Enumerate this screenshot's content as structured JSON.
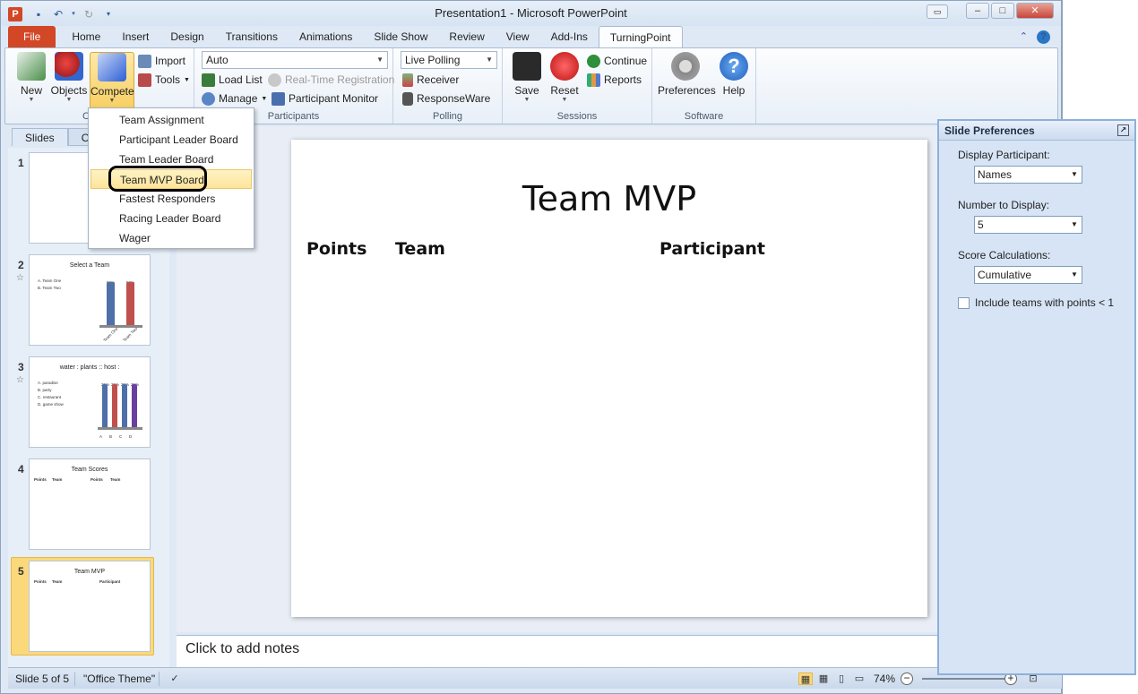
{
  "window": {
    "title": "Presentation1  -  Microsoft PowerPoint",
    "app_icon": "P"
  },
  "tabs": [
    "File",
    "Home",
    "Insert",
    "Design",
    "Transitions",
    "Animations",
    "Slide Show",
    "Review",
    "View",
    "Add-Ins",
    "TurningPoint"
  ],
  "active_tab": "TurningPoint",
  "ribbon": {
    "new": "New",
    "objects": "Objects",
    "compete": "Compete",
    "import": "Import",
    "tools": "Tools",
    "auto_combo": "Auto",
    "load_list": "Load List",
    "realtime_registration": "Real-Time Registration",
    "manage": "Manage",
    "participant_monitor": "Participant Monitor",
    "participants_group": "Participants",
    "polling_combo": "Live Polling",
    "receiver": "Receiver",
    "responseware": "ResponseWare",
    "polling_group": "Polling",
    "save": "Save",
    "reset": "Reset",
    "continue": "Continue",
    "reports": "Reports",
    "sessions_group": "Sessions",
    "preferences": "Preferences",
    "help": "Help",
    "software_group": "Software",
    "content_group_partial": "C"
  },
  "compete_menu": {
    "items": [
      "Team Assignment",
      "Participant Leader Board",
      "Team Leader Board",
      "Team MVP Board",
      "Fastest Responders",
      "Racing Leader Board",
      "Wager"
    ],
    "highlighted": "Team MVP Board"
  },
  "left_pane": {
    "tabs": [
      "Slides",
      "Ou"
    ],
    "slides": [
      {
        "num": "1"
      },
      {
        "num": "2",
        "title": "Select a Team",
        "options": [
          "A. Team One",
          "B. Team Two"
        ],
        "bar_labels": [
          "50%",
          "50%"
        ],
        "axis_labels": [
          "Team One",
          "Team Two"
        ]
      },
      {
        "num": "3",
        "title": "water : plants :: host :",
        "options": [
          "A. paradise",
          "B. party",
          "C. restaurant",
          "D. game show"
        ],
        "bar_labels": [
          "25%",
          "25%",
          "25%",
          "25%"
        ],
        "axis_labels": [
          "A",
          "B",
          "C",
          "D"
        ]
      },
      {
        "num": "4",
        "title": "Team Scores",
        "headers": [
          "Points",
          "Team",
          "Points",
          "Team"
        ]
      },
      {
        "num": "5",
        "title": "Team MVP",
        "headers": [
          "Points",
          "Team",
          "Participant"
        ]
      }
    ],
    "colors": {
      "selected": "#fbd97a",
      "bar_blue": "#4f6fa8",
      "bar_red": "#c0504d",
      "bar_purple": "#6b3fa0"
    }
  },
  "slide": {
    "title": "Team MVP",
    "col_points": "Points",
    "col_team": "Team",
    "col_participant": "Participant"
  },
  "notes_placeholder": "Click to add notes",
  "slide_preferences": {
    "title": "Slide Preferences",
    "display_participant_label": "Display Participant:",
    "display_participant_value": "Names",
    "number_label": "Number to Display:",
    "number_value": "5",
    "score_label": "Score Calculations:",
    "score_value": "Cumulative",
    "include_label": "Include teams with points < 1",
    "include_checked": false
  },
  "statusbar": {
    "slide_info": "Slide 5 of 5",
    "theme": "\"Office Theme\"",
    "zoom": "74%"
  }
}
